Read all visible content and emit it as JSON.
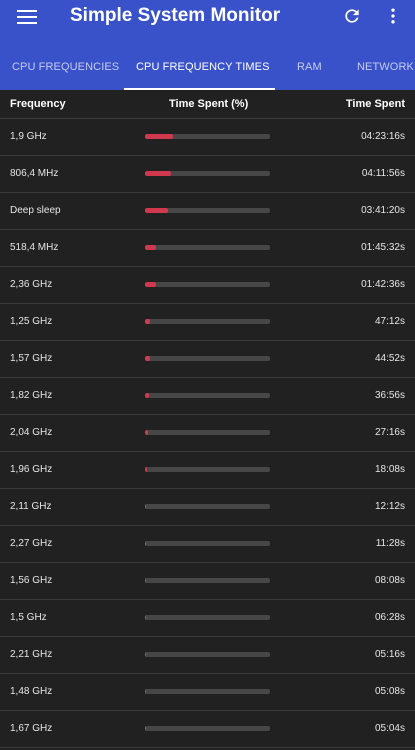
{
  "appbar": {
    "title": "Simple System Monitor",
    "background_color": "#3a52c9",
    "icons": [
      "menu-icon",
      "refresh-icon",
      "more-vert-icon"
    ]
  },
  "tabs": [
    {
      "label": "CPU FREQUENCIES",
      "active": false
    },
    {
      "label": "CPU FREQUENCY TIMES",
      "active": true
    },
    {
      "label": "RAM",
      "active": false
    },
    {
      "label": "NETWORK",
      "active": false
    }
  ],
  "table": {
    "headers": {
      "frequency": "Frequency",
      "percent": "Time Spent (%)",
      "time": "Time Spent"
    },
    "bar_color": "#d0394d",
    "rows": [
      {
        "frequency": "1,9 GHz",
        "percent": 22,
        "time": "04:23:16s"
      },
      {
        "frequency": "806,4 MHz",
        "percent": 21,
        "time": "04:11:56s"
      },
      {
        "frequency": "Deep sleep",
        "percent": 18,
        "time": "03:41:20s"
      },
      {
        "frequency": "518,4 MHz",
        "percent": 9,
        "time": "01:45:32s"
      },
      {
        "frequency": "2,36 GHz",
        "percent": 8.6,
        "time": "01:42:36s"
      },
      {
        "frequency": "1,25 GHz",
        "percent": 4,
        "time": "47:12s"
      },
      {
        "frequency": "1,57 GHz",
        "percent": 3.8,
        "time": "44:52s"
      },
      {
        "frequency": "1,82 GHz",
        "percent": 3.2,
        "time": "36:56s"
      },
      {
        "frequency": "2,04 GHz",
        "percent": 2.4,
        "time": "27:16s"
      },
      {
        "frequency": "1,96 GHz",
        "percent": 1.6,
        "time": "18:08s"
      },
      {
        "frequency": "2,11 GHz",
        "percent": 1.1,
        "time": "12:12s"
      },
      {
        "frequency": "2,27 GHz",
        "percent": 1.0,
        "time": "11:28s"
      },
      {
        "frequency": "1,56 GHz",
        "percent": 0.8,
        "time": "08:08s"
      },
      {
        "frequency": "1,5 GHz",
        "percent": 0.6,
        "time": "06:28s"
      },
      {
        "frequency": "2,21 GHz",
        "percent": 0.5,
        "time": "05:16s"
      },
      {
        "frequency": "1,48 GHz",
        "percent": 0.45,
        "time": "05:08s"
      },
      {
        "frequency": "1,67 GHz",
        "percent": 0.45,
        "time": "05:04s"
      }
    ]
  }
}
